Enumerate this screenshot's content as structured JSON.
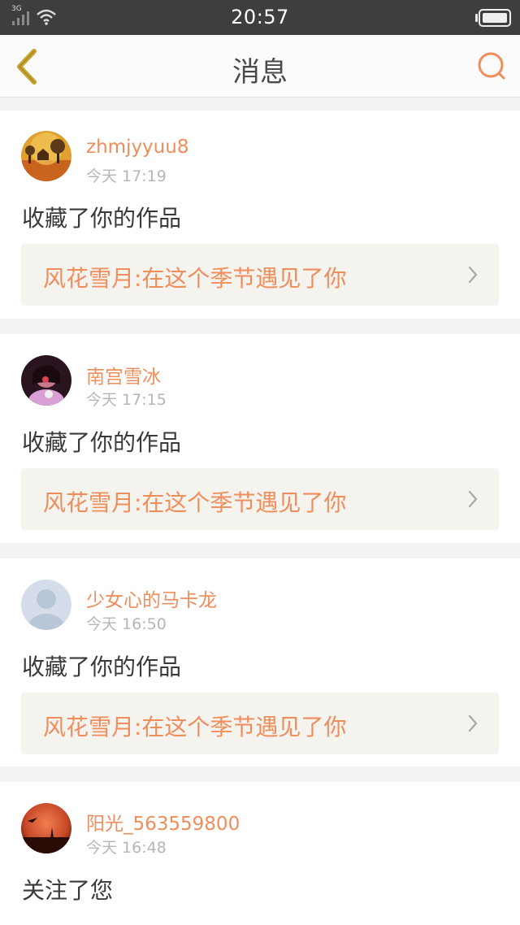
{
  "status_bar": {
    "network": "3G",
    "time": "20:57"
  },
  "nav": {
    "title": "消息",
    "back_icon": "chevron-left-icon",
    "search_icon": "search-icon"
  },
  "colors": {
    "accent": "#ef8e5c",
    "back_icon": "#c9a32b",
    "status_bar": "#3e3e3e",
    "work_box": "#f4f3ee"
  },
  "messages": [
    {
      "username": "zhmjyyuu8",
      "time": "今天 17:19",
      "action": "收藏了你的作品",
      "work_title": "风花雪月:在这个季节遇见了你"
    },
    {
      "username": "南宫雪冰",
      "time": "今天 17:15",
      "action": "收藏了你的作品",
      "work_title": "风花雪月:在这个季节遇见了你"
    },
    {
      "username": "少女心的马卡龙",
      "time": "今天 16:50",
      "action": "收藏了你的作品",
      "work_title": "风花雪月:在这个季节遇见了你"
    },
    {
      "username": "阳光_563559800",
      "time": "今天 16:48",
      "action": "关注了您",
      "work_title": ""
    }
  ]
}
